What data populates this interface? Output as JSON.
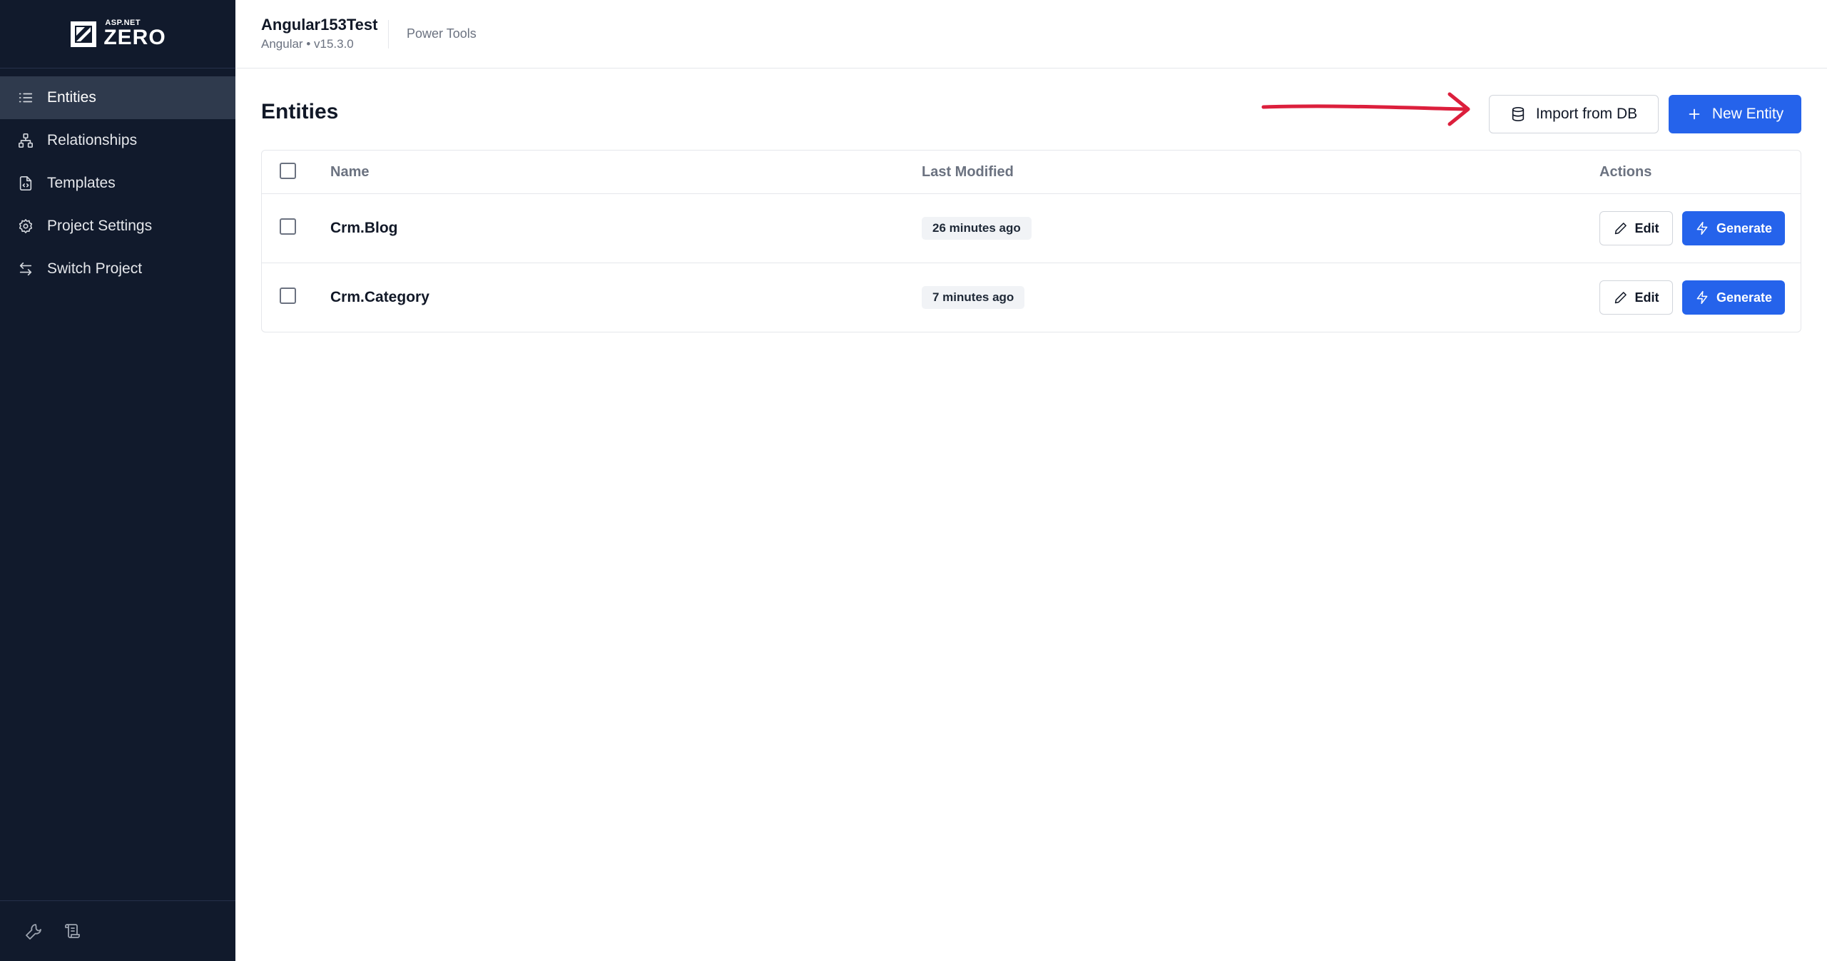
{
  "brand": {
    "logo_top": "ASP.NET",
    "logo_main": "ZERO"
  },
  "sidebar": {
    "items": [
      {
        "label": "Entities",
        "icon": "list-icon",
        "active": true
      },
      {
        "label": "Relationships",
        "icon": "hierarchy-icon",
        "active": false
      },
      {
        "label": "Templates",
        "icon": "file-code-icon",
        "active": false
      },
      {
        "label": "Project Settings",
        "icon": "gear-icon",
        "active": false
      },
      {
        "label": "Switch Project",
        "icon": "switch-arrows-icon",
        "active": false
      }
    ],
    "footer_icons": [
      "wrench-icon",
      "scroll-log-icon"
    ]
  },
  "header": {
    "project_name": "Angular153Test",
    "project_sub": "Angular • v15.3.0",
    "tools_label": "Power Tools"
  },
  "main": {
    "title": "Entities",
    "import_label": "Import from DB",
    "new_label": "New Entity",
    "table": {
      "columns": [
        "Name",
        "Last Modified",
        "Actions"
      ],
      "rows": [
        {
          "name": "Crm.Blog",
          "modified": "26 minutes ago"
        },
        {
          "name": "Crm.Category",
          "modified": "7 minutes ago"
        }
      ],
      "edit_label": "Edit",
      "generate_label": "Generate"
    }
  },
  "colors": {
    "sidebar_bg": "#111a2c",
    "active_item_bg": "#2f3a4d",
    "primary": "#2563eb",
    "annotation_arrow": "#dc1f3c"
  }
}
